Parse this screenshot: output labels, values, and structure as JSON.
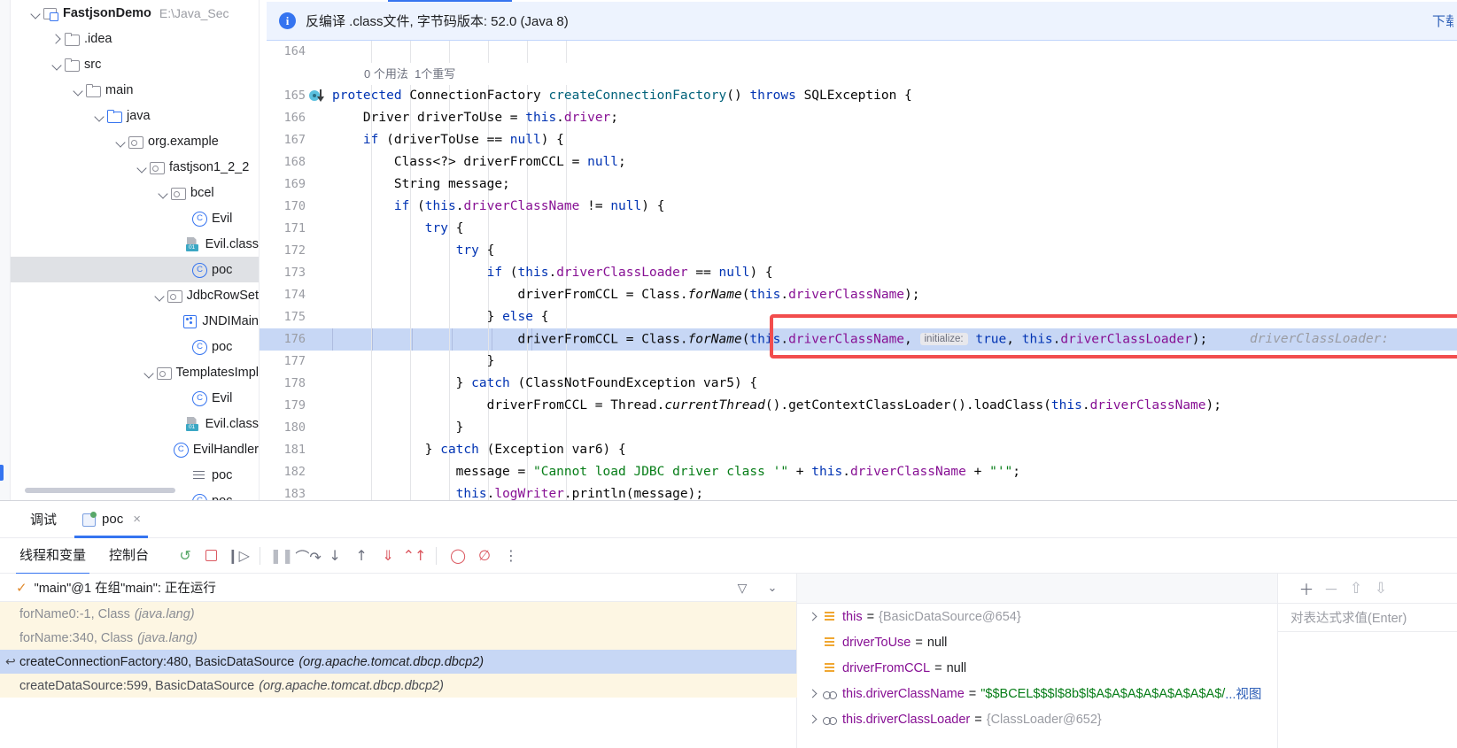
{
  "project_tree": {
    "rows": [
      {
        "indent": 0,
        "chevron": "down",
        "icon": "module-icon",
        "label": "FastjsonDemo",
        "bold": true,
        "sub": "E:\\Java_Sec",
        "selected": false
      },
      {
        "indent": 1,
        "chevron": "right",
        "icon": "folder-icon",
        "label": ".idea",
        "bold": false,
        "sub": "",
        "selected": false
      },
      {
        "indent": 1,
        "chevron": "down",
        "icon": "folder-icon",
        "label": "src",
        "bold": false,
        "sub": "",
        "selected": false
      },
      {
        "indent": 2,
        "chevron": "down",
        "icon": "folder-icon",
        "label": "main",
        "bold": false,
        "sub": "",
        "selected": false
      },
      {
        "indent": 3,
        "chevron": "down",
        "icon": "folder-blue-icon",
        "label": "java",
        "bold": false,
        "sub": "",
        "selected": false
      },
      {
        "indent": 4,
        "chevron": "down",
        "icon": "package-icon",
        "label": "org.example",
        "bold": false,
        "sub": "",
        "selected": false
      },
      {
        "indent": 5,
        "chevron": "down",
        "icon": "package-icon",
        "label": "fastjson1_2_2",
        "bold": false,
        "sub": "",
        "selected": false
      },
      {
        "indent": 6,
        "chevron": "down",
        "icon": "package-icon",
        "label": "bcel",
        "bold": false,
        "sub": "",
        "selected": false
      },
      {
        "indent": 7,
        "chevron": "none",
        "icon": "java-class-icon",
        "label": "Evil",
        "bold": false,
        "sub": "",
        "selected": false
      },
      {
        "indent": 7,
        "chevron": "none",
        "icon": "class-file-icon",
        "label": "Evil.class",
        "bold": false,
        "sub": "",
        "selected": false
      },
      {
        "indent": 7,
        "chevron": "none",
        "icon": "java-class-icon",
        "label": "poc",
        "bold": false,
        "sub": "",
        "selected": true
      },
      {
        "indent": 6,
        "chevron": "down",
        "icon": "package-icon",
        "label": "JdbcRowSet",
        "bold": false,
        "sub": "",
        "selected": false
      },
      {
        "indent": 7,
        "chevron": "none",
        "icon": "jndi-icon",
        "label": "JNDIMain",
        "bold": false,
        "sub": "",
        "selected": false
      },
      {
        "indent": 7,
        "chevron": "none",
        "icon": "java-class-icon",
        "label": "poc",
        "bold": false,
        "sub": "",
        "selected": false
      },
      {
        "indent": 6,
        "chevron": "down",
        "icon": "package-icon",
        "label": "TemplatesImpl",
        "bold": false,
        "sub": "",
        "selected": false
      },
      {
        "indent": 7,
        "chevron": "none",
        "icon": "java-class-icon",
        "label": "Evil",
        "bold": false,
        "sub": "",
        "selected": false
      },
      {
        "indent": 7,
        "chevron": "none",
        "icon": "class-file-icon",
        "label": "Evil.class",
        "bold": false,
        "sub": "",
        "selected": false
      },
      {
        "indent": 7,
        "chevron": "none",
        "icon": "java-class-icon",
        "label": "EvilHandler",
        "bold": false,
        "sub": "",
        "selected": false
      },
      {
        "indent": 7,
        "chevron": "none",
        "icon": "text-file-icon",
        "label": "poc",
        "bold": false,
        "sub": "",
        "selected": false
      },
      {
        "indent": 7,
        "chevron": "none",
        "icon": "java-class-icon",
        "label": "poc",
        "bold": false,
        "sub": "",
        "selected": false
      }
    ]
  },
  "editor": {
    "notification": "反编译 .class文件, 字节码版本: 52.0 (Java 8)",
    "notification_action": "下载",
    "info_icon_glyph": "i",
    "usage_hint": "0 个用法  1个重写",
    "lines": [
      {
        "num": "164",
        "html": ""
      },
      {
        "num": "165",
        "html": "<span class=\"kw\">protected</span> <span class=\"plain\">ConnectionFactory </span><span class=\"mth\">createConnectionFactory</span><span class=\"plain\">() </span><span class=\"kw\">throws</span><span class=\"plain\"> SQLException {</span>",
        "breakpoint": true
      },
      {
        "num": "166",
        "html": "<span class=\"plain\">    Driver driverToUse = </span><span class=\"kw\">this</span><span class=\"plain\">.</span><span class=\"fld\">driver</span><span class=\"plain\">;</span>"
      },
      {
        "num": "167",
        "html": "<span class=\"plain\">    </span><span class=\"kw\">if</span><span class=\"plain\"> (driverToUse == </span><span class=\"kw\">null</span><span class=\"plain\">) {</span>"
      },
      {
        "num": "168",
        "html": "<span class=\"plain\">        Class&lt;?&gt; driverFromCCL = </span><span class=\"kw\">null</span><span class=\"plain\">;</span>"
      },
      {
        "num": "169",
        "html": "<span class=\"plain\">        String message;</span>"
      },
      {
        "num": "170",
        "html": "<span class=\"plain\">        </span><span class=\"kw\">if</span><span class=\"plain\"> (</span><span class=\"kw\">this</span><span class=\"plain\">.</span><span class=\"fld\">driverClassName</span><span class=\"plain\"> != </span><span class=\"kw\">null</span><span class=\"plain\">) {</span>"
      },
      {
        "num": "171",
        "html": "<span class=\"plain\">            </span><span class=\"kw\">try</span><span class=\"plain\"> {</span>"
      },
      {
        "num": "172",
        "html": "<span class=\"plain\">                </span><span class=\"kw\">try</span><span class=\"plain\"> {</span>"
      },
      {
        "num": "173",
        "html": "<span class=\"plain\">                    </span><span class=\"kw\">if</span><span class=\"plain\"> (</span><span class=\"kw\">this</span><span class=\"plain\">.</span><span class=\"fld\">driverClassLoader</span><span class=\"plain\"> == </span><span class=\"kw\">null</span><span class=\"plain\">) {</span>"
      },
      {
        "num": "174",
        "html": "<span class=\"plain\">                        driverFromCCL = Class.</span><span class=\"ital plain\">forName</span><span class=\"plain\">(</span><span class=\"kw\">this</span><span class=\"plain\">.</span><span class=\"fld\">driverClassName</span><span class=\"plain\">);</span>"
      },
      {
        "num": "175",
        "html": "<span class=\"plain\">                    } </span><span class=\"kw\">else</span><span class=\"plain\"> {</span>"
      },
      {
        "num": "176",
        "html": "<span class=\"plain\">                        driverFromCCL = Class.</span><span class=\"ital plain\">forName</span><span class=\"plain\">(</span><span class=\"kw\">this</span><span class=\"plain\">.</span><span class=\"fld\">driverClassName</span><span class=\"plain\">, </span><span class=\"hint-chip\">initialize:</span><span class=\"plain\"> </span><span class=\"kw\">true</span><span class=\"plain\">, </span><span class=\"kw\">this</span><span class=\"plain\">.</span><span class=\"fld\">driverClassLoader</span><span class=\"plain\">);</span>",
        "executing": true,
        "inline_hint": "driverClassLoader:"
      },
      {
        "num": "177",
        "html": "<span class=\"plain\">                    }</span>"
      },
      {
        "num": "178",
        "html": "<span class=\"plain\">                } </span><span class=\"kw\">catch</span><span class=\"plain\"> (ClassNotFoundException var5) {</span>"
      },
      {
        "num": "179",
        "html": "<span class=\"plain\">                    driverFromCCL = Thread.</span><span class=\"ital plain\">currentThread</span><span class=\"plain\">().getContextClassLoader().loadClass(</span><span class=\"kw\">this</span><span class=\"plain\">.</span><span class=\"fld\">driverClassName</span><span class=\"plain\">);</span>"
      },
      {
        "num": "180",
        "html": "<span class=\"plain\">                }</span>"
      },
      {
        "num": "181",
        "html": "<span class=\"plain\">            } </span><span class=\"kw\">catch</span><span class=\"plain\"> (Exception var6) {</span>"
      },
      {
        "num": "182",
        "html": "<span class=\"plain\">                message = </span><span class=\"str\">\"Cannot load JDBC driver class '\"</span><span class=\"plain\"> + </span><span class=\"kw\">this</span><span class=\"plain\">.</span><span class=\"fld\">driverClassName</span><span class=\"plain\"> + </span><span class=\"str\">\"'\"</span><span class=\"plain\">;</span>"
      },
      {
        "num": "183",
        "html": "<span class=\"plain\">                </span><span class=\"kw\">this</span><span class=\"plain\">.</span><span class=\"fld\">logWriter</span><span class=\"plain\">.println(message);</span>"
      }
    ]
  },
  "debug": {
    "tab_label": "调试",
    "run_tab_label": "poc",
    "close_label": "×",
    "subtabs": [
      {
        "label": "线程和变量",
        "active": true
      },
      {
        "label": "控制台",
        "active": false
      }
    ],
    "toolbar_icons": [
      {
        "name": "rerun-icon",
        "glyph": "↺",
        "color": "green"
      },
      {
        "name": "stop-icon",
        "glyph": "",
        "color": "red"
      },
      {
        "name": "resume-icon",
        "glyph": "❙▷",
        "color": ""
      },
      {
        "name": "pause-icon",
        "glyph": "❚❚",
        "color": "gray"
      },
      {
        "name": "step-over-icon",
        "glyph": "⌒↷",
        "color": ""
      },
      {
        "name": "step-into-icon",
        "glyph": "↓",
        "color": ""
      },
      {
        "name": "step-out-icon",
        "glyph": "↑",
        "color": ""
      },
      {
        "name": "force-step-into-icon",
        "glyph": "⇓",
        "color": "red"
      },
      {
        "name": "run-to-cursor-icon",
        "glyph": "⌃↑",
        "color": "red"
      },
      {
        "name": "view-breakpoints-icon",
        "glyph": "◯",
        "color": "red"
      },
      {
        "name": "mute-breakpoints-icon",
        "glyph": "∅",
        "color": "red"
      },
      {
        "name": "more-options-icon",
        "glyph": "⋮",
        "color": ""
      }
    ],
    "thread": {
      "check_glyph": "✓",
      "label": "\"main\"@1 在组\"main\": 正在运行"
    },
    "frames": [
      {
        "text": "forName0:-1, Class ",
        "pkg": "(java.lang)",
        "state": "lib"
      },
      {
        "text": "forName:340, Class ",
        "pkg": "(java.lang)",
        "state": "lib"
      },
      {
        "text": "createConnectionFactory:480, BasicDataSource ",
        "pkg": "(org.apache.tomcat.dbcp.dbcp2)",
        "state": "sel",
        "has_return_icon": true
      },
      {
        "text": "createDataSource:599, BasicDataSource ",
        "pkg": "(org.apache.tomcat.dbcp.dbcp2)",
        "state": "app"
      }
    ],
    "variables": [
      {
        "chevron": true,
        "icon": "local-var-icon",
        "name": "this",
        "value": "{BasicDataSource@654}",
        "value_kind": "obj"
      },
      {
        "chevron": false,
        "icon": "local-var-icon",
        "name": "driverToUse",
        "value": "null",
        "value_kind": "null"
      },
      {
        "chevron": false,
        "icon": "local-var-icon",
        "name": "driverFromCCL",
        "value": "null",
        "value_kind": "null"
      },
      {
        "chevron": true,
        "icon": "field-icon",
        "name": "this.driverClassName",
        "value": "\"$$BCEL$$$l$8b$l$A$A$A$A$A$A$A$A$/",
        "value_kind": "str",
        "suffix": "...视图"
      },
      {
        "chevron": true,
        "icon": "field-icon",
        "name": "this.driverClassLoader",
        "value": "{ClassLoader@652}",
        "value_kind": "obj"
      }
    ],
    "watch": {
      "add_glyph": "＋",
      "remove_glyph": "－",
      "up_glyph": "⇧",
      "down_glyph": "⇩",
      "placeholder": "对表达式求值(Enter)"
    }
  }
}
